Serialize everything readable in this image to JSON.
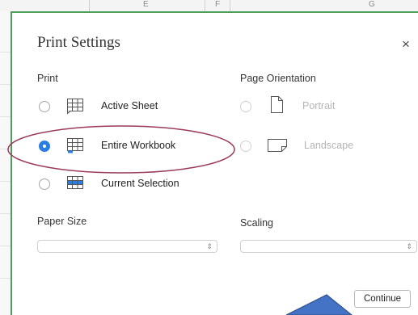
{
  "spreadsheet": {
    "columns": [
      "E",
      "F",
      "G"
    ]
  },
  "dialog": {
    "title": "Print Settings",
    "close_symbol": "×",
    "print_section": {
      "label": "Print",
      "options": [
        {
          "label": "Active Sheet",
          "selected": false,
          "icon": "active-sheet-grid-icon"
        },
        {
          "label": "Entire Workbook",
          "selected": true,
          "icon": "workbook-grid-icon"
        },
        {
          "label": "Current Selection",
          "selected": false,
          "icon": "selection-grid-icon"
        }
      ]
    },
    "orientation_section": {
      "label": "Page Orientation",
      "options": [
        {
          "label": "Portrait",
          "selected": false,
          "disabled": true,
          "icon": "portrait-page-icon"
        },
        {
          "label": "Landscape",
          "selected": false,
          "disabled": true,
          "icon": "landscape-page-icon"
        }
      ]
    },
    "paper_size": {
      "label": "Paper Size",
      "value": ""
    },
    "scaling": {
      "label": "Scaling",
      "value": ""
    },
    "continue_label": "Continue"
  },
  "colors": {
    "accent": "#2a7de1",
    "sheet_border": "#4d9e5b",
    "annotation_ellipse": "#9c3a5c",
    "annotation_arrow_fill": "#4472c4",
    "annotation_arrow_stroke": "#2f528f"
  }
}
